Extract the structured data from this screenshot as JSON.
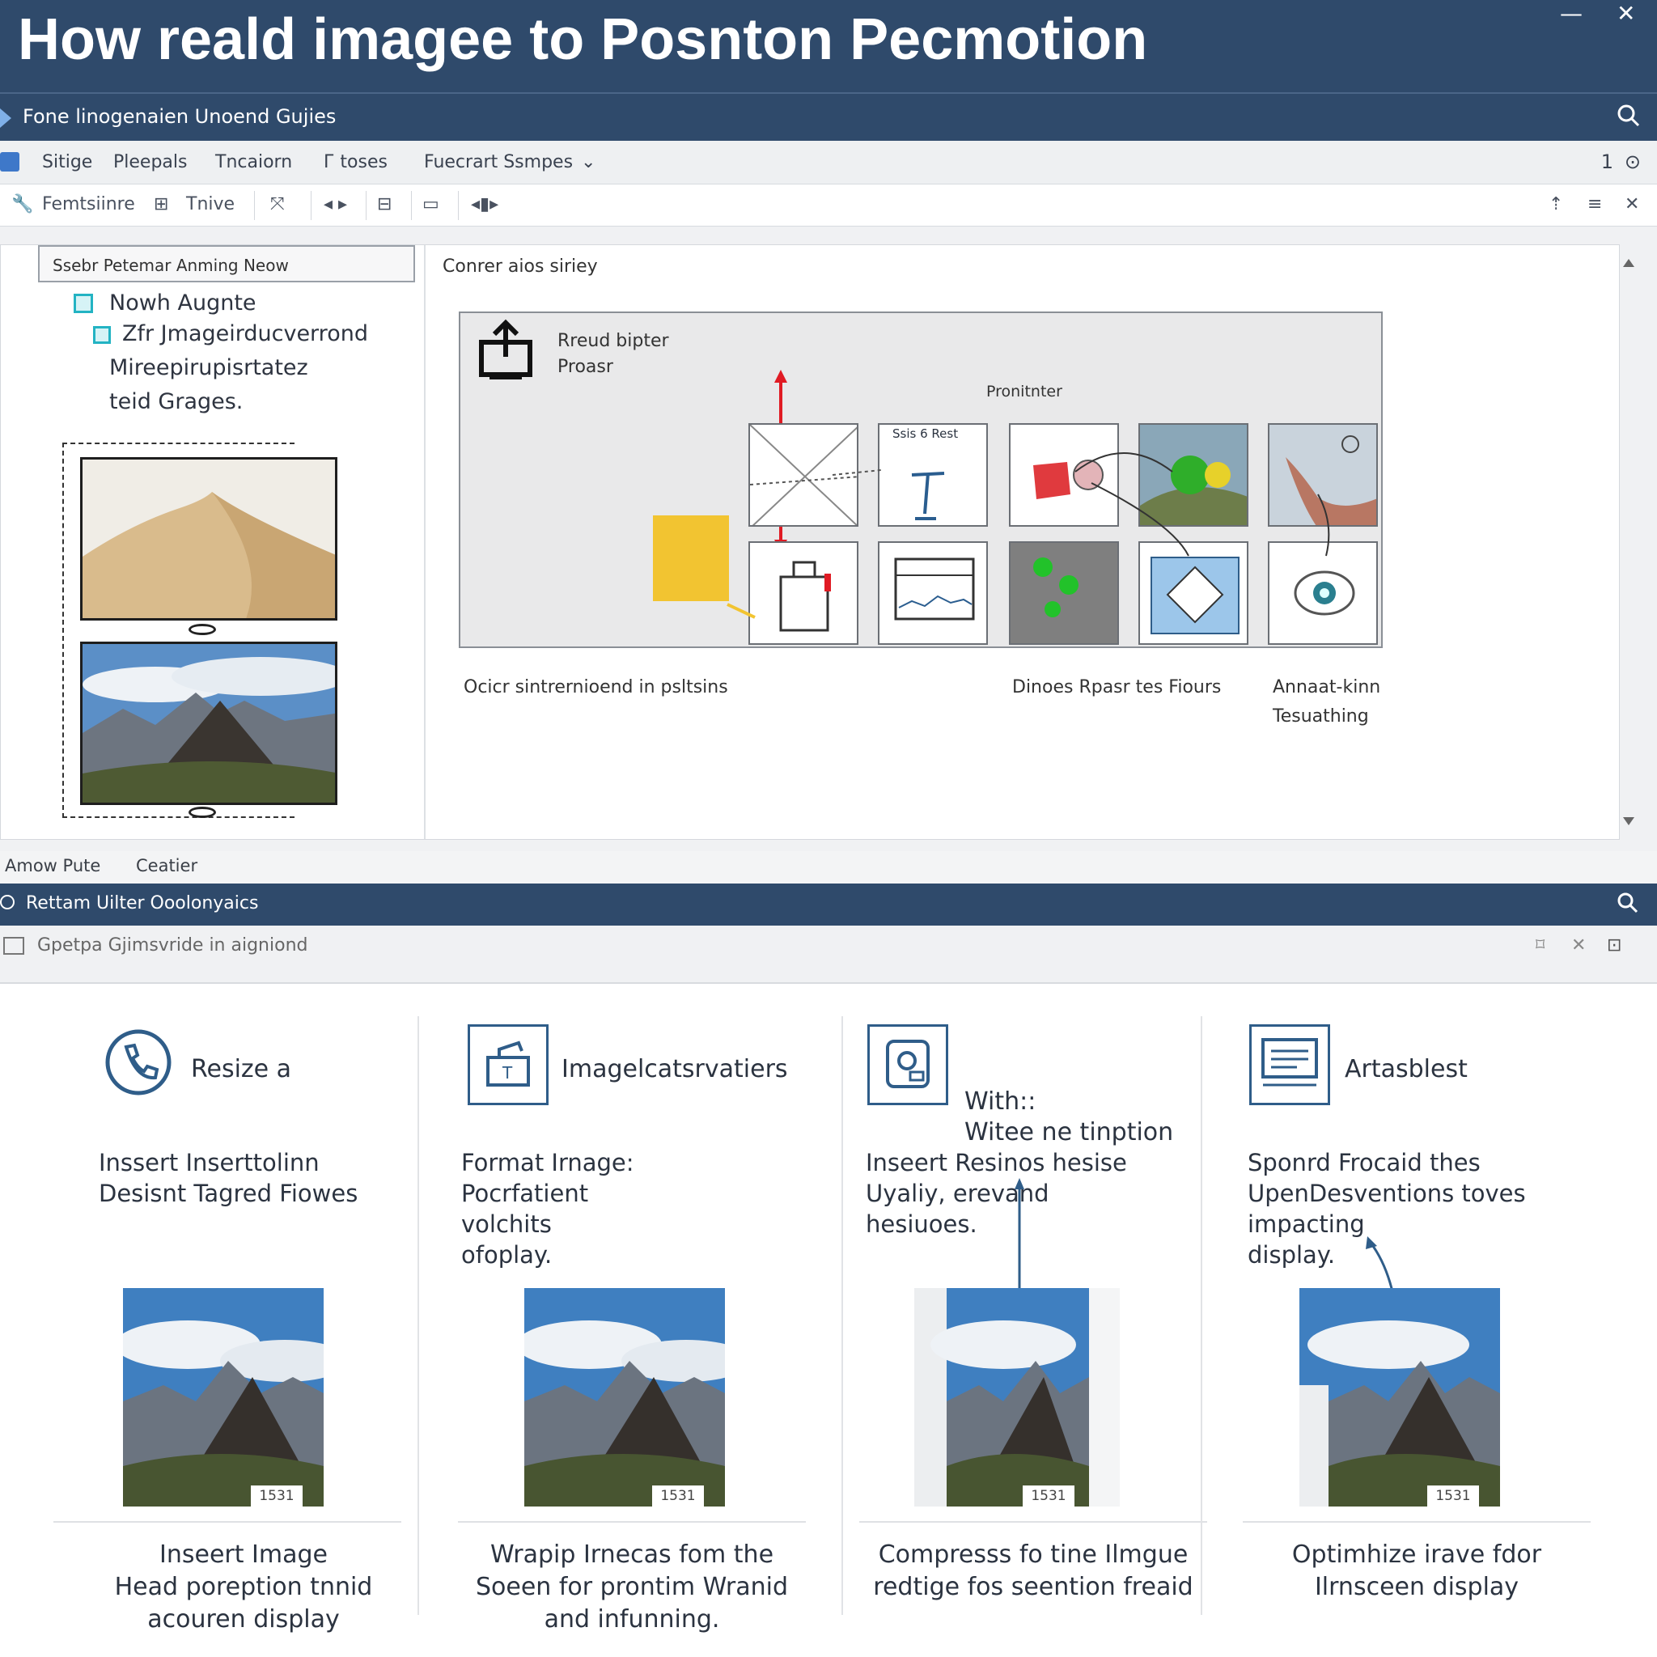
{
  "window": {
    "title": "How reald imagee to Posnton Pecmotion"
  },
  "nav": {
    "label": "Fone linogenaien Unoend Gujies"
  },
  "menu": {
    "items": [
      "Sitige",
      "Pleepals",
      "Tncaiorn",
      "Г toses",
      "Fuecrart Ssmpes"
    ],
    "right_label": "1"
  },
  "toolbar": {
    "items": [
      "Femtsiinre",
      "Tnive"
    ]
  },
  "sidebar": {
    "search": "Ssebr Petemar  Anming Neow",
    "tree": [
      "Nowh Augnte",
      "Zfr Jmageirducverrond",
      "Mireepirupisrtatez",
      "teid Grages."
    ]
  },
  "main": {
    "heading": "Conrer aios siriey",
    "box_label_1": "Rreud bipter",
    "box_label_2": "Proasr",
    "center_label": "Pronitnter",
    "cell_label": "Ssis 6 Rest",
    "caption_left": "Ocicr sintrernioend in psltsins",
    "caption_mid": "Dinoes Rpasr tes Fiours",
    "caption_right_1": "Annaat-kinn",
    "caption_right_2": "Tesuathing"
  },
  "status": {
    "left": "Amow Pute",
    "right": "Ceatier"
  },
  "bar2": {
    "label": "Rettam Uilter Ooolonyaics"
  },
  "bar3": {
    "label": "Gpetpa Gjimsvride in aigniond"
  },
  "cards": [
    {
      "title": "Resize a",
      "body": [
        "Inssert Inserttolinn",
        "Desisnt Tagred Fiowes"
      ],
      "badge": "1531",
      "footer": [
        "Inseert Image",
        "Head poreption tnnid",
        "acouren display"
      ]
    },
    {
      "title": "Imagelcatsrvatiers",
      "body": [
        "Format Irnage:",
        "Pocrfatient",
        "volchits",
        "ofoplay."
      ],
      "badge": "1531",
      "footer": [
        "Wrapip Irnecas fom the",
        "Soeen for prontim Wranid",
        "and infunning."
      ]
    },
    {
      "title_1": "With::",
      "title_2": "Witee ne tinption",
      "body": [
        "Inseert Resinos hesise",
        "Uyaliy, erevand",
        "hesiuoes."
      ],
      "badge": "1531",
      "footer": [
        "Compresss fo tine Ilmgue",
        "redtige fos seention freaid"
      ]
    },
    {
      "title": "Artasblest",
      "body": [
        "Sponrd Frocaid thes",
        "UpenDesventions toves",
        "impacting",
        "display."
      ],
      "badge": "1531",
      "footer": [
        "Optimhize irave fdor",
        "Ilrnsceen display"
      ]
    }
  ]
}
